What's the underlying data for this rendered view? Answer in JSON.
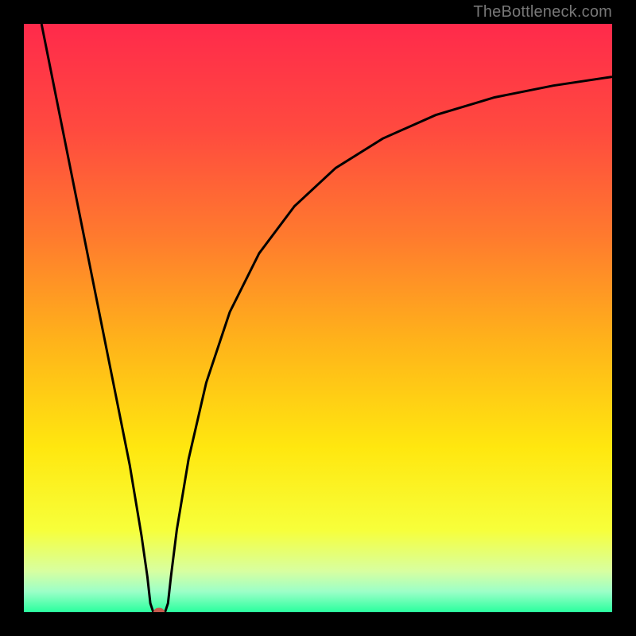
{
  "watermark": "TheBottleneck.com",
  "chart_data": {
    "type": "line",
    "title": "",
    "xlabel": "",
    "ylabel": "",
    "xlim": [
      0,
      100
    ],
    "ylim": [
      0,
      100
    ],
    "grid": false,
    "legend": false,
    "background_gradient": {
      "stops": [
        {
          "pos": 0.0,
          "color": "#ff2a4b"
        },
        {
          "pos": 0.18,
          "color": "#ff4a3f"
        },
        {
          "pos": 0.36,
          "color": "#ff7a2e"
        },
        {
          "pos": 0.54,
          "color": "#ffb31a"
        },
        {
          "pos": 0.72,
          "color": "#ffe70f"
        },
        {
          "pos": 0.86,
          "color": "#f7ff3a"
        },
        {
          "pos": 0.93,
          "color": "#d8ffa0"
        },
        {
          "pos": 0.965,
          "color": "#9cffc8"
        },
        {
          "pos": 1.0,
          "color": "#2aff9e"
        }
      ]
    },
    "series": [
      {
        "name": "curve",
        "color": "#000000",
        "points": [
          {
            "x": 3.0,
            "y": 100.0
          },
          {
            "x": 6.0,
            "y": 85.0
          },
          {
            "x": 9.0,
            "y": 70.0
          },
          {
            "x": 12.0,
            "y": 55.0
          },
          {
            "x": 15.0,
            "y": 40.0
          },
          {
            "x": 18.0,
            "y": 25.0
          },
          {
            "x": 20.0,
            "y": 13.0
          },
          {
            "x": 21.0,
            "y": 6.0
          },
          {
            "x": 21.5,
            "y": 1.5
          },
          {
            "x": 22.0,
            "y": 0.0
          },
          {
            "x": 23.0,
            "y": 0.0
          },
          {
            "x": 24.0,
            "y": 0.0
          },
          {
            "x": 24.5,
            "y": 1.5
          },
          {
            "x": 25.0,
            "y": 6.0
          },
          {
            "x": 26.0,
            "y": 14.0
          },
          {
            "x": 28.0,
            "y": 26.0
          },
          {
            "x": 31.0,
            "y": 39.0
          },
          {
            "x": 35.0,
            "y": 51.0
          },
          {
            "x": 40.0,
            "y": 61.0
          },
          {
            "x": 46.0,
            "y": 69.0
          },
          {
            "x": 53.0,
            "y": 75.5
          },
          {
            "x": 61.0,
            "y": 80.5
          },
          {
            "x": 70.0,
            "y": 84.5
          },
          {
            "x": 80.0,
            "y": 87.5
          },
          {
            "x": 90.0,
            "y": 89.5
          },
          {
            "x": 100.0,
            "y": 91.0
          }
        ]
      }
    ],
    "marker": {
      "x": 23.0,
      "y": 0.0,
      "color": "#c65a4e"
    }
  }
}
